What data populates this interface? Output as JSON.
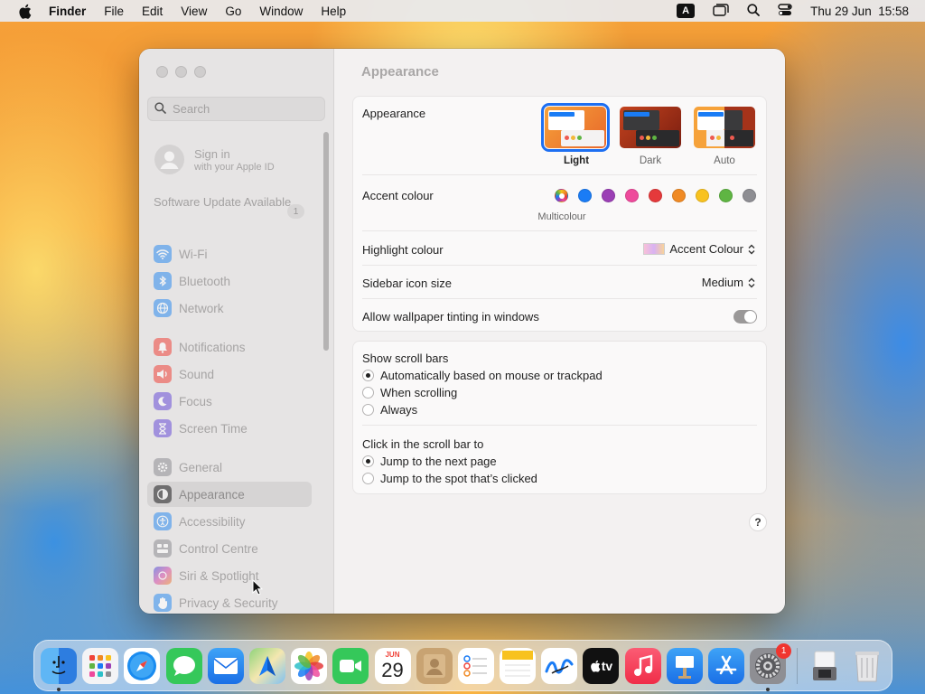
{
  "menubar": {
    "app_name": "Finder",
    "items": [
      "File",
      "Edit",
      "View",
      "Go",
      "Window",
      "Help"
    ],
    "input_badge": "A",
    "clock": "Thu 29 Jun  15:58"
  },
  "sidebar": {
    "search_placeholder": "Search",
    "signin_title": "Sign in",
    "signin_subtitle": "with your Apple ID",
    "update_label": "Software Update Available",
    "update_count": "1",
    "items": [
      {
        "label": "Wi-Fi",
        "icon": "wifi-icon",
        "color": "#2d8cf0"
      },
      {
        "label": "Bluetooth",
        "icon": "bluetooth-icon",
        "color": "#2d8cf0"
      },
      {
        "label": "Network",
        "icon": "globe-icon",
        "color": "#2d8cf0"
      },
      {
        "label": "Notifications",
        "icon": "bell-icon",
        "color": "#f0443a"
      },
      {
        "label": "Sound",
        "icon": "speaker-icon",
        "color": "#f0443a"
      },
      {
        "label": "Focus",
        "icon": "moon-icon",
        "color": "#6a4fd8"
      },
      {
        "label": "Screen Time",
        "icon": "hourglass-icon",
        "color": "#6a4fd8"
      },
      {
        "label": "General",
        "icon": "gear-icon",
        "color": "#8e8e93"
      },
      {
        "label": "Appearance",
        "icon": "appearance-icon",
        "color": "#1c1c1e"
      },
      {
        "label": "Accessibility",
        "icon": "accessibility-icon",
        "color": "#2d8cf0"
      },
      {
        "label": "Control Centre",
        "icon": "control-centre-icon",
        "color": "#8e8e93"
      },
      {
        "label": "Siri & Spotlight",
        "icon": "siri-icon",
        "color": "#d64aa8"
      },
      {
        "label": "Privacy & Security",
        "icon": "hand-icon",
        "color": "#2d8cf0"
      }
    ]
  },
  "main": {
    "title": "Appearance",
    "appearance_label": "Appearance",
    "appearance_options": [
      "Light",
      "Dark",
      "Auto"
    ],
    "appearance_selected": "Light",
    "accent_label": "Accent colour",
    "accent_selected_name": "Multicolour",
    "accent_colors": [
      "multicolour",
      "#1a7cf5",
      "#9b3fb5",
      "#ee4a9c",
      "#e5393b",
      "#f08a24",
      "#f8c21f",
      "#5fb543",
      "#8e8e93"
    ],
    "highlight_label": "Highlight colour",
    "highlight_value": "Accent Colour",
    "sidebar_icon_label": "Sidebar icon size",
    "sidebar_icon_value": "Medium",
    "tinting_label": "Allow wallpaper tinting in windows",
    "tinting_on": true,
    "scroll_bars_label": "Show scroll bars",
    "scroll_options": [
      "Automatically based on mouse or trackpad",
      "When scrolling",
      "Always"
    ],
    "click_label": "Click in the scroll bar to",
    "click_options": [
      "Jump to the next page",
      "Jump to the spot that’s clicked"
    ],
    "help": "?"
  },
  "dock": {
    "calendar_month": "JUN",
    "calendar_day": "29",
    "tv_label": "tv",
    "settings_badge": "1",
    "apps": [
      "finder",
      "launchpad",
      "safari",
      "messages",
      "mail",
      "maps",
      "photos",
      "facetime",
      "calendar",
      "contacts",
      "reminders",
      "notes",
      "freeform",
      "tv",
      "music",
      "keynote",
      "app-store",
      "system-settings",
      "preview",
      "trash"
    ]
  }
}
